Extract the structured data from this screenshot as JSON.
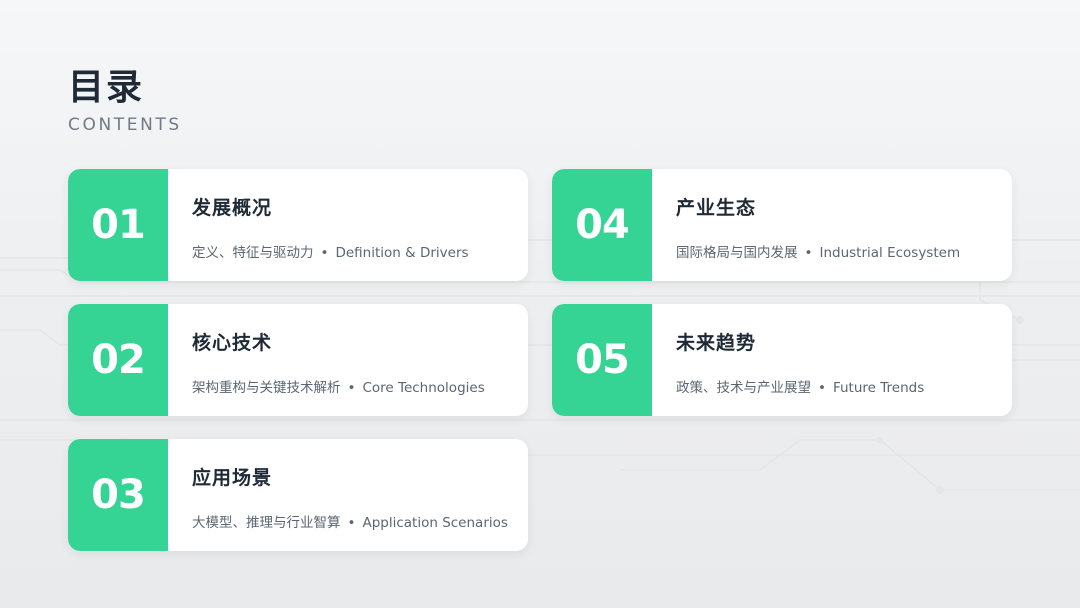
{
  "header": {
    "title": "目录",
    "subtitle": "CONTENTS"
  },
  "accent_color": "#35d495",
  "sections": [
    {
      "number": "01",
      "title": "发展概况",
      "desc_cn": "定义、特征与驱动力",
      "desc_en": "Definition & Drivers"
    },
    {
      "number": "02",
      "title": "核心技术",
      "desc_cn": "架构重构与关键技术解析",
      "desc_en": "Core Technologies"
    },
    {
      "number": "03",
      "title": "应用场景",
      "desc_cn": "大模型、推理与行业智算",
      "desc_en": "Application Scenarios"
    },
    {
      "number": "04",
      "title": "产业生态",
      "desc_cn": "国际格局与国内发展",
      "desc_en": "Industrial Ecosystem"
    },
    {
      "number": "05",
      "title": "未来趋势",
      "desc_cn": "政策、技术与产业展望",
      "desc_en": "Future Trends"
    }
  ],
  "separator": "•"
}
